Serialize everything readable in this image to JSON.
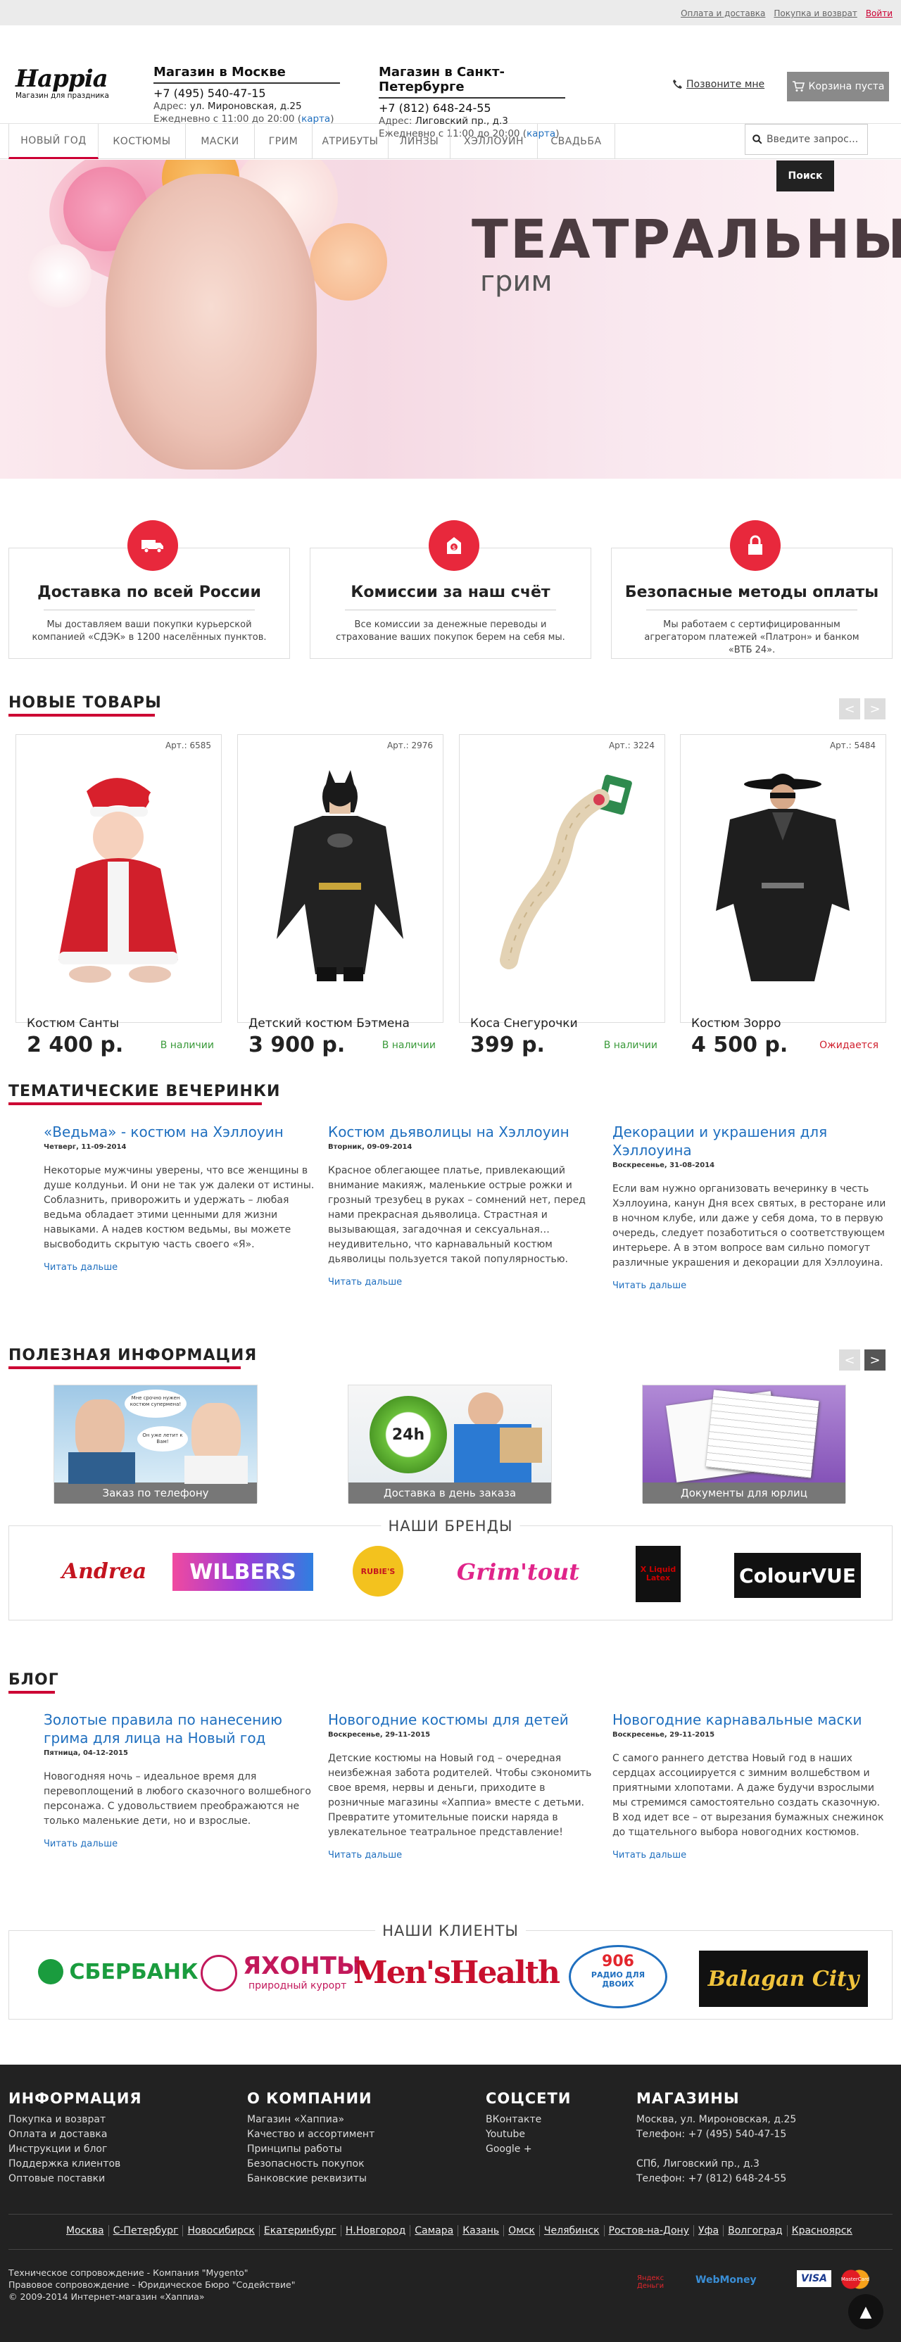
{
  "toplinks": [
    "Оплата и доставка",
    "Покупка и возврат",
    "Войти"
  ],
  "logo": {
    "name": "Happia",
    "tagline": "Магазин для праздника"
  },
  "stores": [
    {
      "title": "Магазин в Москве",
      "phone": "+7 (495) 540-47-15",
      "addr_label": "Адрес:",
      "addr": "ул. Мироновская, д.25",
      "hours": "Ежедневно с 11:00 до 20:00 (",
      "map": "карта",
      ")": ")"
    },
    {
      "title": "Магазин в Санкт-Петербурге",
      "phone": "+7 (812) 648-24-55",
      "addr_label": "Адрес:",
      "addr": "Лиговский пр., д.3",
      "hours": "Ежедневно с 11:00 до 20:00 (",
      "map": "карта",
      ")": ")"
    }
  ],
  "callme": "Позвоните мне",
  "cart": "Корзина пуста",
  "nav": [
    "НОВЫЙ ГОД",
    "КОСТЮМЫ",
    "МАСКИ",
    "ГРИМ",
    "АТРИБУТЫ",
    "ЛИНЗЫ",
    "ХЭЛЛОУИН",
    "СВАДЬБА"
  ],
  "search": {
    "placeholder": "Введите запрос...",
    "button": "Поиск"
  },
  "hero": {
    "title": "ТЕАТРАЛЬНЫЙ",
    "subtitle": "грим"
  },
  "features": [
    {
      "title": "Доставка по всей России",
      "text": "Мы доставляем ваши покупки курьерской компанией «СДЭК» в 1200 населённых пунктов.",
      "icon": "truck-icon"
    },
    {
      "title": "Комиссии за наш счёт",
      "text": "Все комиссии за денежные переводы и страхование ваших покупок берем на себя мы.",
      "icon": "money-icon"
    },
    {
      "title": "Безопасные методы оплаты",
      "text": "Мы работаем с сертифицированным агрегатором платежей «Платрон» и банком «ВТБ 24».",
      "icon": "lock-icon"
    }
  ],
  "new_title": "НОВЫЕ ТОВАРЫ",
  "arrows": [
    "<",
    ">"
  ],
  "products": [
    {
      "art": "Арт.: 6585",
      "name": "Костюм Санты",
      "price": "2 400 р.",
      "status": "В наличии",
      "status_color": "#3a9a3a"
    },
    {
      "art": "Арт.: 2976",
      "name": "Детский костюм Бэтмена",
      "price": "3 900 р.",
      "status": "В наличии",
      "status_color": "#3a9a3a"
    },
    {
      "art": "Арт.: 3224",
      "name": "Коса Снегурочки",
      "price": "399 р.",
      "status": "В наличии",
      "status_color": "#3a9a3a"
    },
    {
      "art": "Арт.: 5484",
      "name": "Костюм Зорро",
      "price": "4 500 р.",
      "status": "Ожидается",
      "status_color": "#d0202e"
    }
  ],
  "themed_title": "ТЕМАТИЧЕСКИЕ ВЕЧЕРИНКИ",
  "themed": [
    {
      "title": "«Ведьма» - костюм на Хэллоуин",
      "date": "Четверг, 11-09-2014",
      "text": "Некоторые мужчины уверены, что все женщины в душе колдуньи. И они не так уж далеки от истины. Соблазнить, приворожить и удержать – любая ведьма обладает этими ценными для жизни навыками. А надев костюм ведьмы, вы можете высвободить скрытую часть своего «Я».",
      "more": "Читать дальше"
    },
    {
      "title": "Костюм дьяволицы на Хэллоуин",
      "date": "Вторник, 09-09-2014",
      "text": "Красное облегающее платье, привлекающий внимание макияж, маленькие острые рожки и грозный трезубец в руках – сомнений нет, перед нами прекрасная дьяволица. Страстная и вызывающая, загадочная и сексуальная… неудивительно, что карнавальный костюм дьяволицы пользуется такой популярностью.",
      "more": "Читать дальше"
    },
    {
      "title": "Декорации и украшения для Хэллоуина",
      "date": "Воскресенье, 31-08-2014",
      "text": "Если вам нужно организовать вечеринку в честь Хэллоуина, канун Дня всех святых, в ресторане или в ночном клубе, или даже у себя дома, то в первую очередь, следует позаботиться о соответствующем интерьере. А в этом вопросе вам сильно помогут различные украшения и декорации для Хэллоуина.",
      "more": "Читать дальше"
    }
  ],
  "info_title": "ПОЛЕЗНАЯ ИНФОРМАЦИЯ",
  "info": [
    {
      "caption": "Заказ по телефону",
      "bubble1": "Мне срочно нужен костюм супермена!",
      "bubble2": "Он уже летит к Вам!"
    },
    {
      "caption": "Доставка в день заказа",
      "badge": "24h"
    },
    {
      "caption": "Документы для юрлиц"
    }
  ],
  "brands_title": "НАШИ БРЕНДЫ",
  "brands": [
    "Andrea",
    "WILBERS",
    "RUBIE'S",
    "Grim'tout",
    "X Liquid Latex",
    "ColourVUE"
  ],
  "blog_title": "БЛОГ",
  "blog": [
    {
      "title": "Золотые правила по нанесению грима для лица на Новый год",
      "date": "Пятница, 04-12-2015",
      "text": "Новогодняя ночь – идеальное время для перевоплощений в любого сказочного волшебного персонажа. С удовольствием преображаются не только маленькие дети, но и взрослые.",
      "more": "Читать дальше"
    },
    {
      "title": "Новогодние костюмы для детей",
      "date": "Воскресенье, 29-11-2015",
      "text": "Детские костюмы на Новый год – очередная неизбежная забота родителей. Чтобы сэкономить свое время, нервы и деньги, приходите в розничные магазины «Хаппиа» вместе с детьми. Превратите утомительные поиски наряда в увлекательное театральное представление!",
      "more": "Читать дальше"
    },
    {
      "title": "Новогодние карнавальные маски",
      "date": "Воскресенье, 29-11-2015",
      "text": "С самого раннего детства Новый год в наших сердцах ассоциируется с зимним волшебством и приятными хлопотами. А даже будучи взрослыми мы стремимся самостоятельно создать сказочную. В ход идет все – от вырезания бумажных снежинок до тщательного выбора новогодних костюмов.",
      "more": "Читать дальше"
    }
  ],
  "clients_title": "НАШИ КЛИЕНТЫ",
  "clients": [
    "СБЕРБАНК",
    "ЯХОНТЫ",
    "природный курорт",
    "Men'sHealth",
    "906",
    "РАДИО ДЛЯ ДВОИХ",
    "Balagan City"
  ],
  "footer": {
    "cols": [
      {
        "title": "ИНФОРМАЦИЯ",
        "links": [
          "Покупка и возврат",
          "Оплата и доставка",
          "Инструкции и блог",
          "Поддержка клиентов",
          "Оптовые поставки"
        ]
      },
      {
        "title": "О КОМПАНИИ",
        "links": [
          "Магазин «Хаппиа»",
          "Качество и ассортимент",
          "Принципы работы",
          "Безопасность покупок",
          "Банковские реквизиты"
        ]
      },
      {
        "title": "СОЦСЕТИ",
        "links": [
          "ВКонтакте",
          "Youtube",
          "Google +"
        ]
      },
      {
        "title": "МАГАЗИНЫ",
        "links": [
          "Москва, ул. Мироновская, д.25",
          "Телефон: +7 (495) 540-47-15",
          "",
          "СПб, Лиговский пр., д.3",
          "Телефон: +7 (812) 648-24-55"
        ]
      }
    ],
    "cities": [
      "Москва",
      "С-Петербург",
      "Новосибирск",
      "Екатеринбург",
      "Н.Новгород",
      "Самара",
      "Казань",
      "Омск",
      "Челябинск",
      "Ростов-на-Дону",
      "Уфа",
      "Волгоград",
      "Красноярск"
    ],
    "copy": [
      "Техническое сопровождение - Компания \"Mygento\"",
      "Правовое сопровождение - Юридическое Бюро \"Содействие\"",
      "© 2009-2014 Интернет-магазин «Хаппиа»"
    ],
    "pay": [
      "Яндекс Деньги",
      "WebMoney",
      "VISA",
      "MasterCard"
    ]
  }
}
